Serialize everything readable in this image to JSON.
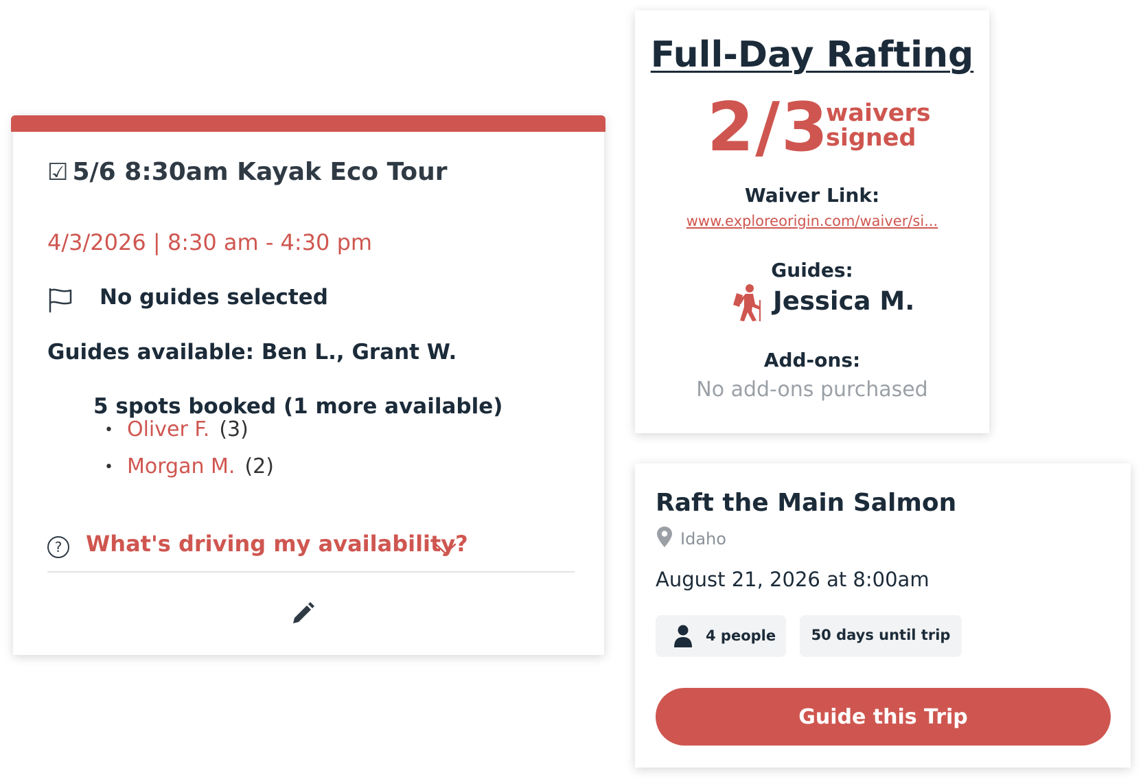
{
  "colors": {
    "accent": "#cf5650",
    "text_dark": "#1c2b39",
    "text_muted": "#9aa0a6",
    "chip_bg": "#f2f3f4"
  },
  "tour_card": {
    "checkbox_glyph": "☑",
    "title": "5/6 8:30am Kayak Eco Tour",
    "date_line": "4/3/2026 | 8:30 am - 4:30 pm",
    "no_guides": "No guides selected",
    "guides_available": "Guides available: Ben L., Grant W.",
    "spots": "5 spots booked (1 more available)",
    "bookings": [
      {
        "name": "Oliver F.",
        "count": "(3)"
      },
      {
        "name": "Morgan M.",
        "count": "(2)"
      }
    ],
    "availability_link": "What's driving my availability?",
    "icons": {
      "flag": "flag-icon",
      "help": "question-circle-icon",
      "chevron": "chevron-down-icon",
      "edit": "pencil-icon"
    }
  },
  "raft_card": {
    "title": "Full-Day Rafting",
    "waiver_count": "2/3",
    "waiver_label_line1": "waivers",
    "waiver_label_line2": "signed",
    "waiver_link_label": "Waiver Link:",
    "waiver_link": "www.exploreorigin.com/waiver/si...",
    "guides_label": "Guides:",
    "guide_name": "Jessica M.",
    "addons_label": "Add-ons:",
    "addons_value": "No add-ons purchased",
    "icons": {
      "guide": "hiker-icon"
    }
  },
  "salmon_card": {
    "title": "Raft the Main Salmon",
    "location": "Idaho",
    "date": "August 21, 2026 at 8:00am",
    "people_chip": "4 people",
    "days_chip": "50 days until trip",
    "button_label": "Guide this Trip",
    "icons": {
      "location": "map-pin-icon",
      "people": "person-icon"
    }
  }
}
